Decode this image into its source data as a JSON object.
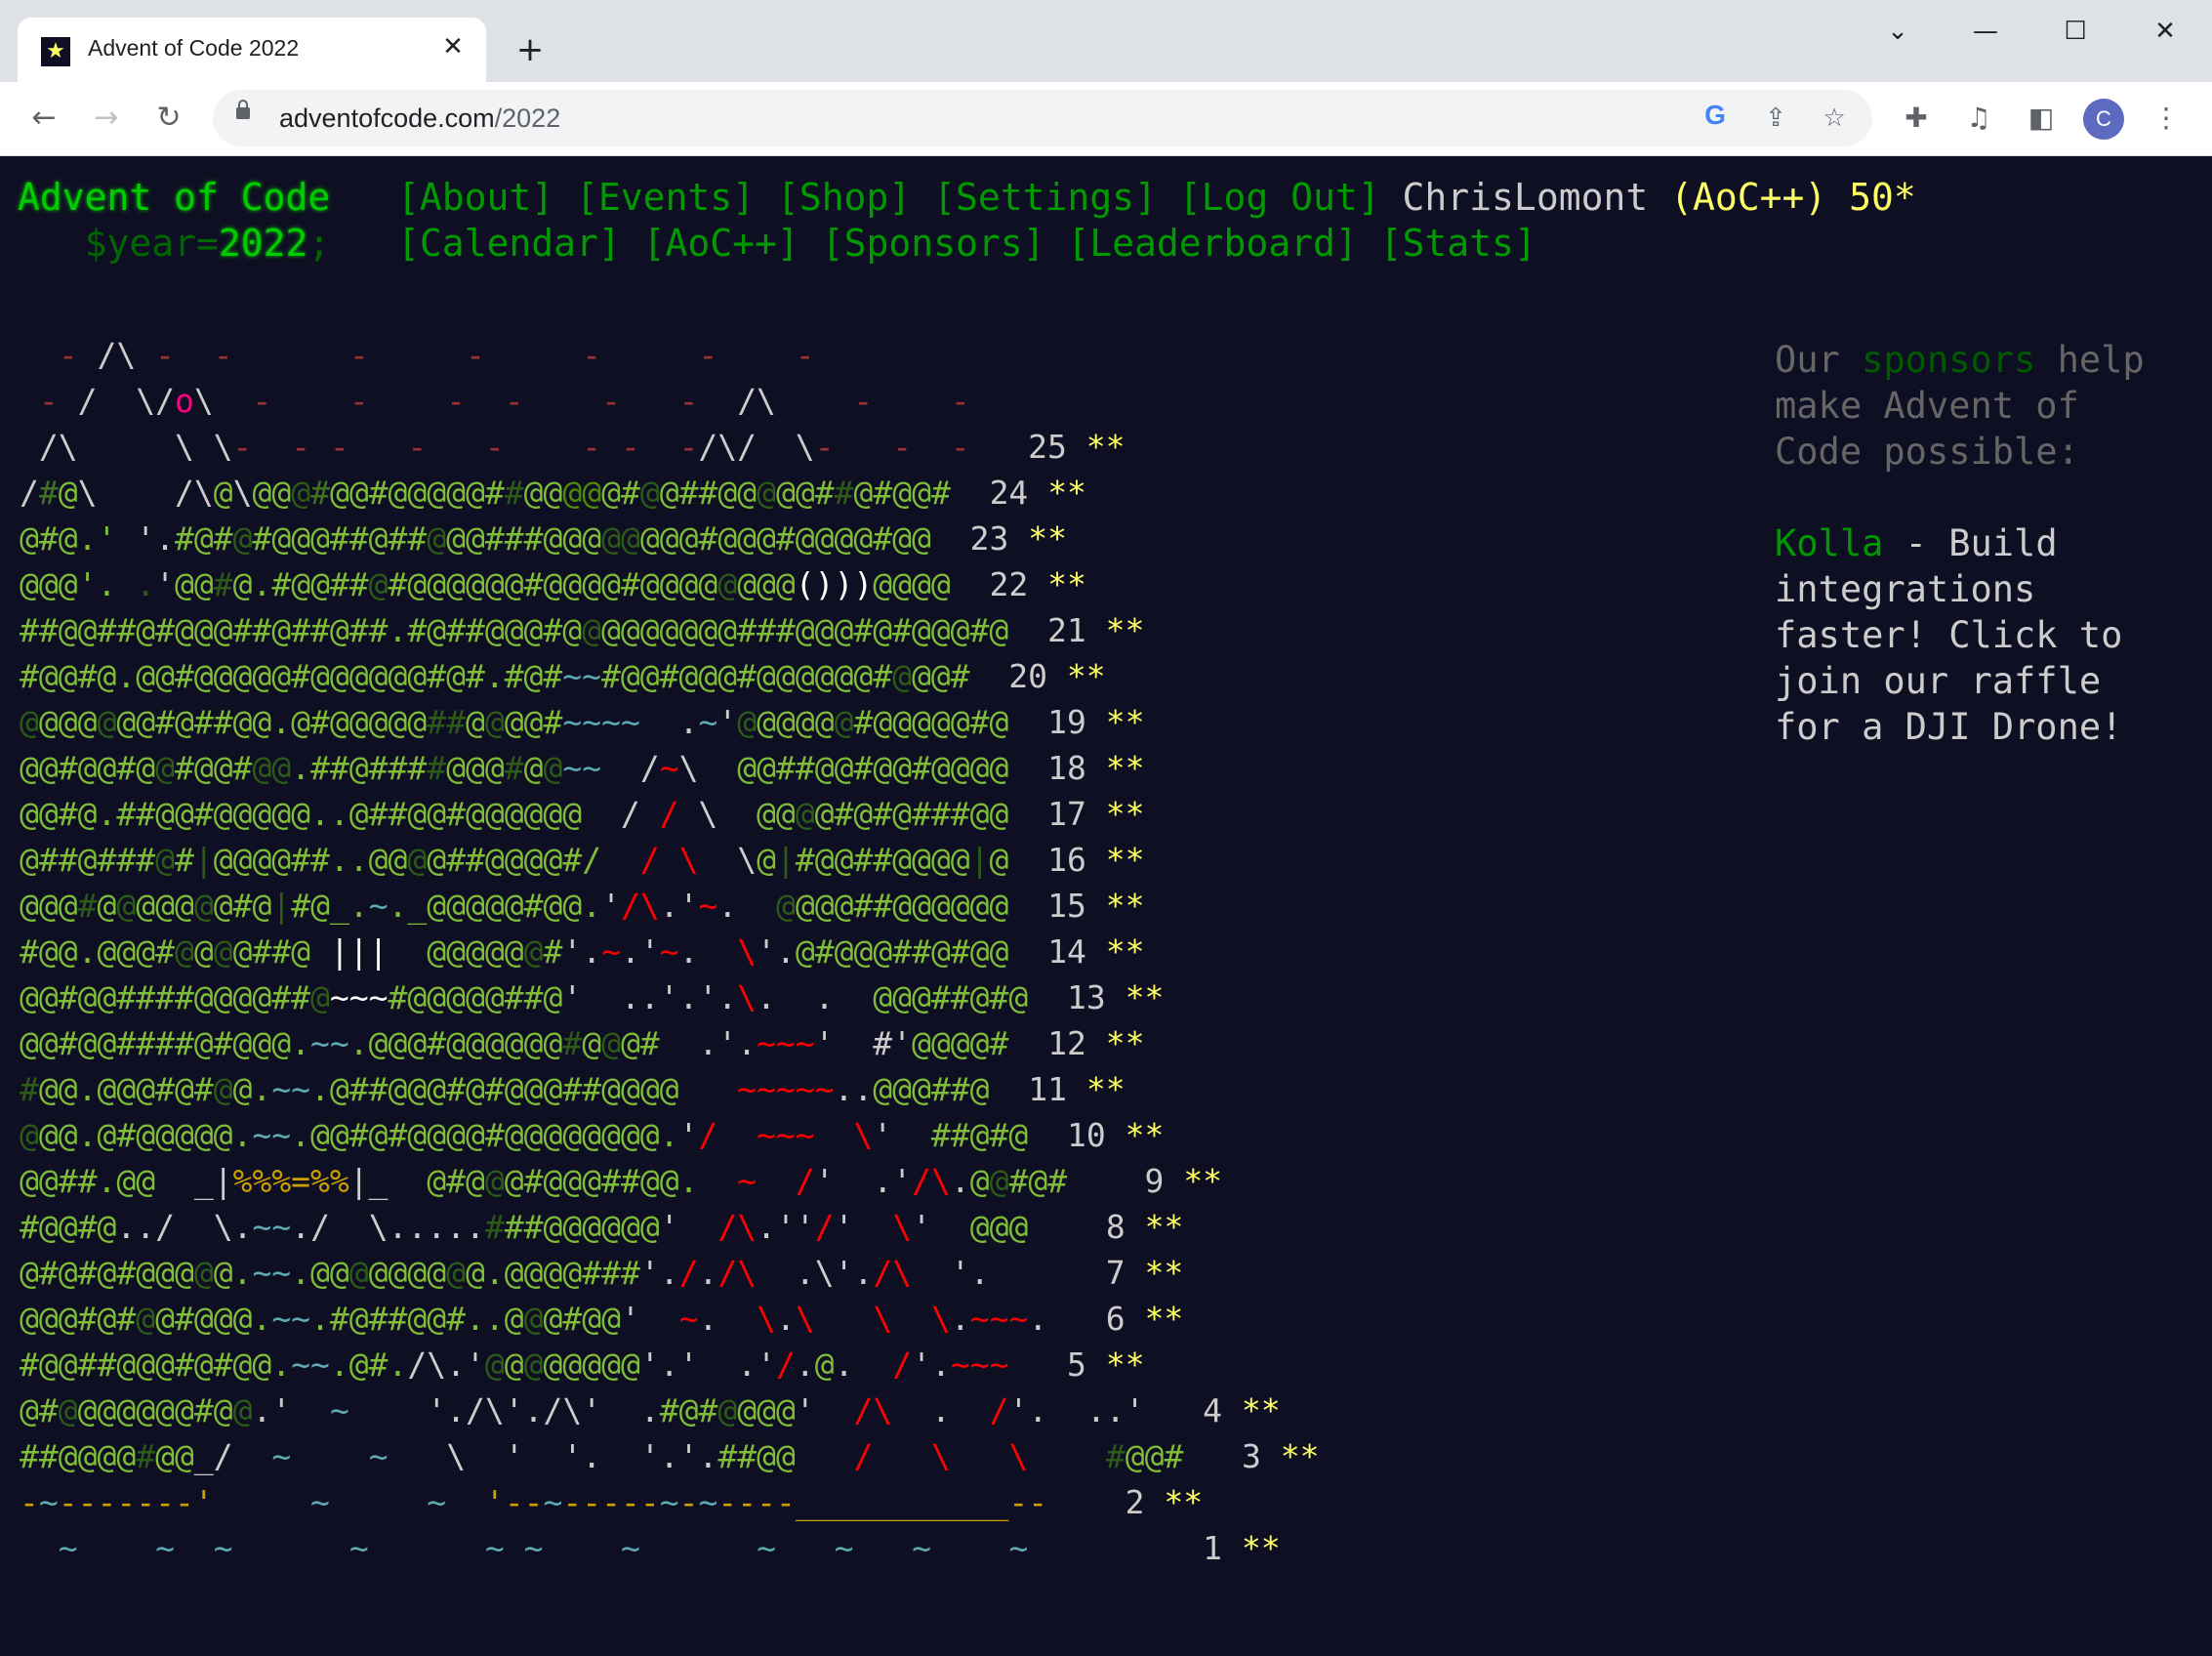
{
  "browser": {
    "tab_title": "Advent of Code 2022",
    "tab_close": "✕",
    "new_tab": "+",
    "favicon_glyph": "★",
    "url_host": "adventofcode.com",
    "url_path": "/2022",
    "window_controls": [
      "⌄",
      "—",
      "☐",
      "✕"
    ],
    "avatar_letter": "C",
    "icons": [
      "back-arrow-icon",
      "forward-arrow-icon",
      "reload-icon",
      "lock-icon",
      "google-icon",
      "share-icon",
      "star-icon",
      "extensions-icon",
      "media-icon",
      "side-panel-icon",
      "menu-icon"
    ]
  },
  "header": {
    "logo": "Advent of Code",
    "year_prefix": "$year=",
    "year": "2022",
    "year_suffix": ";",
    "nav_row1": [
      "[About]",
      "[Events]",
      "[Shop]",
      "[Settings]",
      "[Log Out]"
    ],
    "user_name": "ChrisLomont",
    "user_badge": "(AoC++)",
    "user_stars": "50*",
    "nav_row2": [
      "[Calendar]",
      "[AoC++]",
      "[Sponsors]",
      "[Leaderboard]",
      "[Stats]"
    ]
  },
  "calendar": {
    "stars": "**",
    "days": [
      25,
      24,
      23,
      22,
      21,
      20,
      19,
      18,
      17,
      16,
      15,
      14,
      13,
      12,
      11,
      10,
      9,
      8,
      7,
      6,
      5,
      4,
      3,
      2,
      1
    ]
  },
  "sponsor": {
    "intro_pre": "Our ",
    "intro_link": "sponsors",
    "intro_post": " help make Advent of Code possible:",
    "name": "Kolla",
    "text": " - Build integrations faster! Click to join our raffle for a DJI Drone!"
  },
  "colors": {
    "background": "#0f0f23",
    "green_bright": "#00cc00",
    "green_link": "#009900",
    "gold_star": "#ffff66"
  }
}
